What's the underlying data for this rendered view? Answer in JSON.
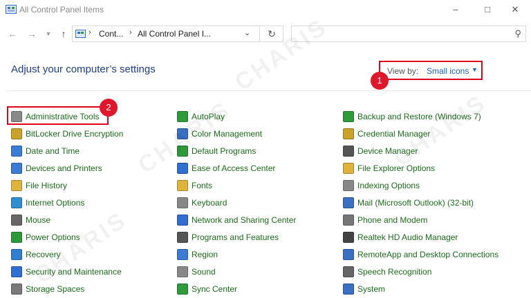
{
  "window": {
    "title": "All Control Panel Items"
  },
  "nav": {
    "crumbs": [
      "Cont...",
      "All Control Panel I..."
    ]
  },
  "search": {
    "placeholder": ""
  },
  "heading": "Adjust your computer’s settings",
  "view_by": {
    "label": "View by:",
    "value": "Small icons"
  },
  "badges": [
    "1",
    "2"
  ],
  "watermark_text": "CHARIS",
  "columns": [
    [
      {
        "label": "Administrative Tools",
        "icon": "gear-tools-icon",
        "color": "#8a8a8a"
      },
      {
        "label": "BitLocker Drive Encryption",
        "icon": "bitlocker-icon",
        "color": "#c9a227"
      },
      {
        "label": "Date and Time",
        "icon": "clock-icon",
        "color": "#3a7bd5"
      },
      {
        "label": "Devices and Printers",
        "icon": "printer-icon",
        "color": "#3a7bd5"
      },
      {
        "label": "File History",
        "icon": "file-history-icon",
        "color": "#e0b33a"
      },
      {
        "label": "Internet Options",
        "icon": "globe-icon",
        "color": "#2f8fd1"
      },
      {
        "label": "Mouse",
        "icon": "mouse-icon",
        "color": "#666666"
      },
      {
        "label": "Power Options",
        "icon": "power-icon",
        "color": "#2e9b3a"
      },
      {
        "label": "Recovery",
        "icon": "recovery-icon",
        "color": "#2f7fd1"
      },
      {
        "label": "Security and Maintenance",
        "icon": "flag-icon",
        "color": "#2f6fd1"
      },
      {
        "label": "Storage Spaces",
        "icon": "storage-icon",
        "color": "#7a7a7a"
      }
    ],
    [
      {
        "label": "AutoPlay",
        "icon": "autoplay-icon",
        "color": "#2e9b3a"
      },
      {
        "label": "Color Management",
        "icon": "monitor-icon",
        "color": "#3a6fc4"
      },
      {
        "label": "Default Programs",
        "icon": "default-programs-icon",
        "color": "#2e9b3a"
      },
      {
        "label": "Ease of Access Center",
        "icon": "ease-of-access-icon",
        "color": "#2f6fd1"
      },
      {
        "label": "Fonts",
        "icon": "fonts-icon",
        "color": "#e0b33a"
      },
      {
        "label": "Keyboard",
        "icon": "keyboard-icon",
        "color": "#888888"
      },
      {
        "label": "Network and Sharing Center",
        "icon": "network-icon",
        "color": "#2f6fd1"
      },
      {
        "label": "Programs and Features",
        "icon": "programs-icon",
        "color": "#555555"
      },
      {
        "label": "Region",
        "icon": "region-icon",
        "color": "#3a7bd5"
      },
      {
        "label": "Sound",
        "icon": "speaker-icon",
        "color": "#888888"
      },
      {
        "label": "Sync Center",
        "icon": "sync-icon",
        "color": "#2e9b3a"
      }
    ],
    [
      {
        "label": "Backup and Restore (Windows 7)",
        "icon": "backup-icon",
        "color": "#2e9b3a"
      },
      {
        "label": "Credential Manager",
        "icon": "credential-icon",
        "color": "#c9a227"
      },
      {
        "label": "Device Manager",
        "icon": "device-manager-icon",
        "color": "#555555"
      },
      {
        "label": "File Explorer Options",
        "icon": "folder-options-icon",
        "color": "#e0b33a"
      },
      {
        "label": "Indexing Options",
        "icon": "indexing-icon",
        "color": "#888888"
      },
      {
        "label": "Mail (Microsoft Outlook) (32-bit)",
        "icon": "mail-icon",
        "color": "#3a6fc4"
      },
      {
        "label": "Phone and Modem",
        "icon": "phone-modem-icon",
        "color": "#777777"
      },
      {
        "label": "Realtek HD Audio Manager",
        "icon": "audio-manager-icon",
        "color": "#444444"
      },
      {
        "label": "RemoteApp and Desktop Connections",
        "icon": "remoteapp-icon",
        "color": "#3a6fc4"
      },
      {
        "label": "Speech Recognition",
        "icon": "microphone-icon",
        "color": "#666666"
      },
      {
        "label": "System",
        "icon": "system-icon",
        "color": "#3a6fc4"
      }
    ]
  ]
}
